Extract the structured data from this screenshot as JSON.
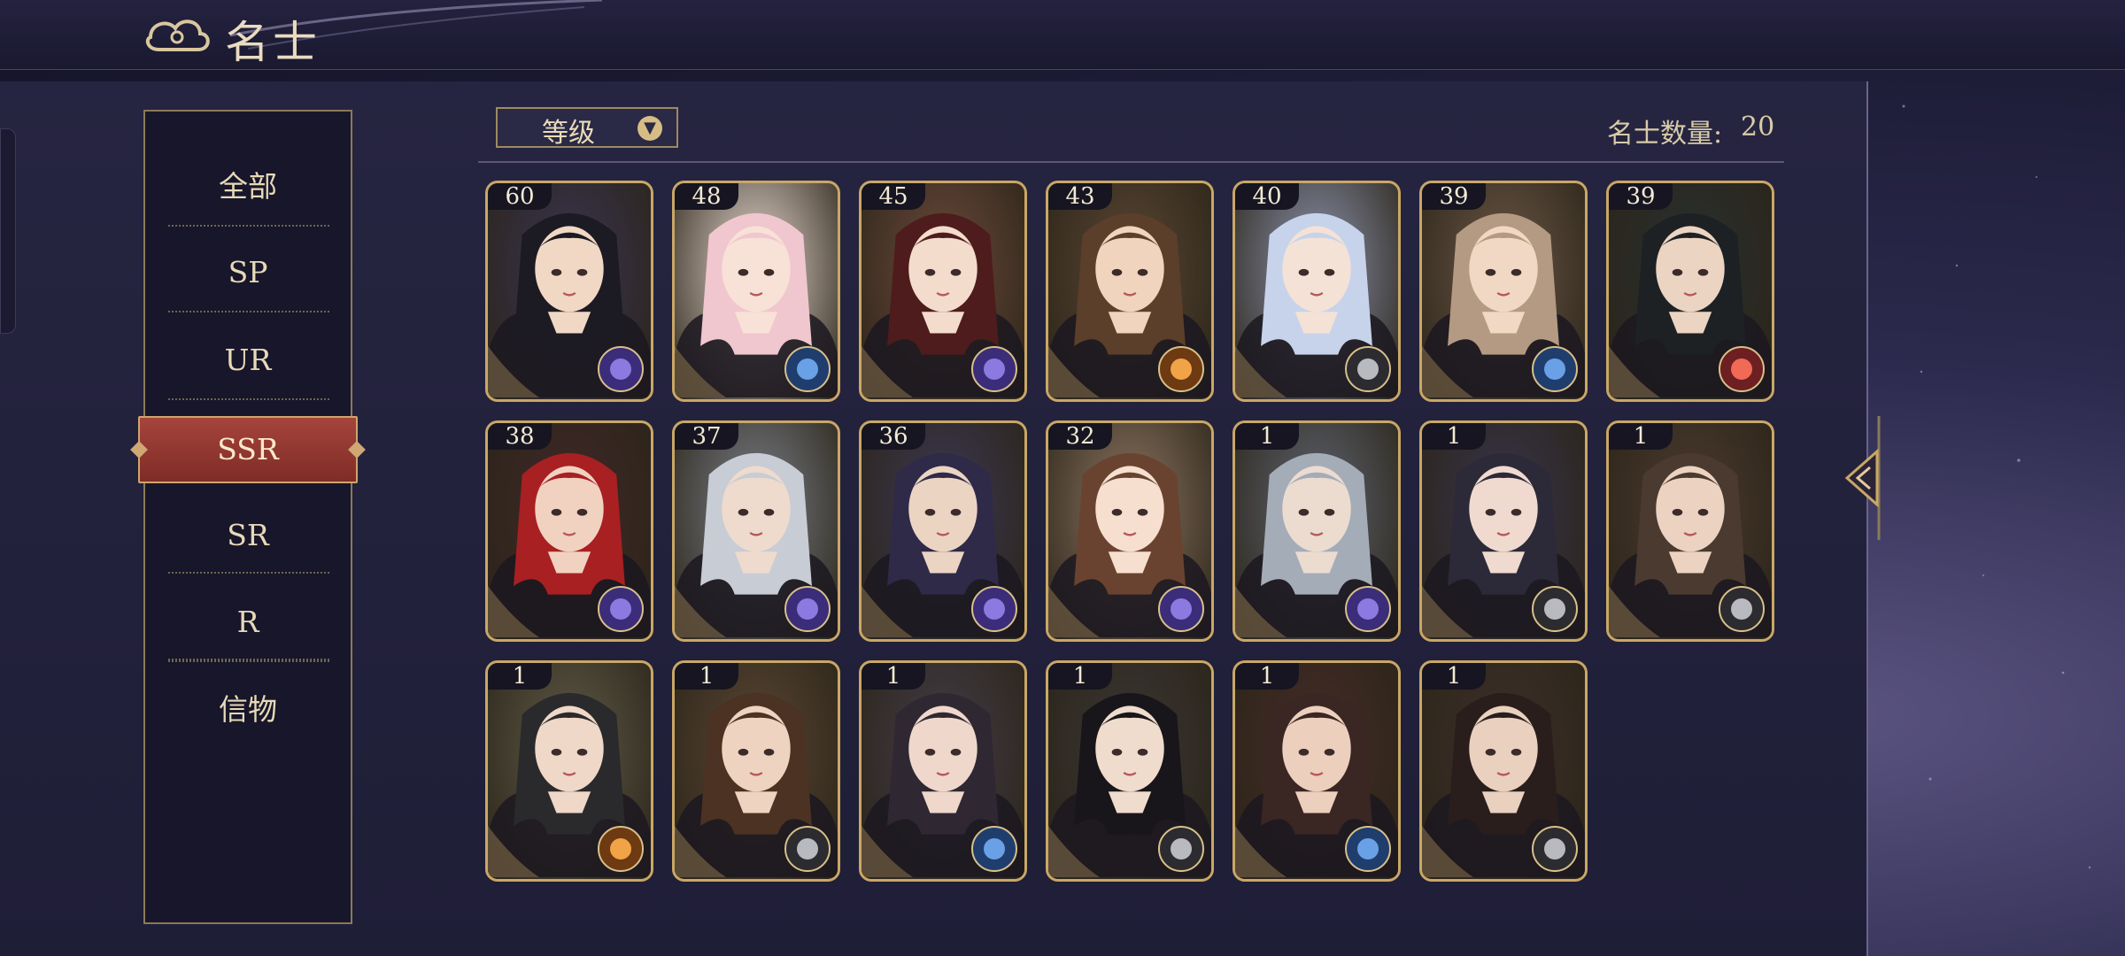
{
  "header": {
    "title": "名士"
  },
  "categories": [
    {
      "label": "全部",
      "active": false
    },
    {
      "label": "SP",
      "active": false
    },
    {
      "label": "UR",
      "active": false
    },
    {
      "label": "SSR",
      "active": true
    },
    {
      "label": "SR",
      "active": false
    },
    {
      "label": "R",
      "active": false
    },
    {
      "label": "信物",
      "active": false
    }
  ],
  "sort": {
    "label": "等级",
    "icon": "chevron-down-icon"
  },
  "count": {
    "label": "名士数量:",
    "value": "20"
  },
  "colors": {
    "accent_gold": "#c9a766",
    "active_red": "#9b3c35",
    "text_cream": "#e7d9b8"
  },
  "cards": [
    {
      "level": "60",
      "hair": "#1c1a22",
      "skin": "#f1d8c4",
      "bg": "#3a3452",
      "badge": "purple-globe-icon"
    },
    {
      "level": "48",
      "hair": "#f0c6cf",
      "skin": "#f8e1d6",
      "bg": "#e7d8d0",
      "badge": "blue-globe-icon"
    },
    {
      "level": "45",
      "hair": "#4e1c1c",
      "skin": "#f3dccc",
      "bg": "#6c4a3c",
      "badge": "purple-globe-icon"
    },
    {
      "level": "43",
      "hair": "#5b3f2a",
      "skin": "#f0d4bd",
      "bg": "#5a4633",
      "badge": "orange-globe-icon"
    },
    {
      "level": "40",
      "hair": "#c7d3ea",
      "skin": "#f4e2d6",
      "bg": "#8c93ad",
      "badge": "grey-compass-icon"
    },
    {
      "level": "39",
      "hair": "#b49a82",
      "skin": "#f1d8c4",
      "bg": "#6a5646",
      "badge": "blue-globe-icon"
    },
    {
      "level": "39",
      "hair": "#1d2124",
      "skin": "#ecd4c2",
      "bg": "#2a3030",
      "badge": "red-globe-icon"
    },
    {
      "level": "38",
      "hair": "#a82022",
      "skin": "#f1d2c0",
      "bg": "#402828",
      "badge": "purple-globe-icon"
    },
    {
      "level": "37",
      "hair": "#c8ccd4",
      "skin": "#eedbcd",
      "bg": "#7b7f88",
      "badge": "purple-globe-icon"
    },
    {
      "level": "36",
      "hair": "#2e2a48",
      "skin": "#ecd4c3",
      "bg": "#3c3852",
      "badge": "purple-globe-icon"
    },
    {
      "level": "32",
      "hair": "#6a4330",
      "skin": "#f6dfcf",
      "bg": "#8d7562",
      "badge": "purple-globe-icon"
    },
    {
      "level": "1",
      "hair": "#a4acb8",
      "skin": "#ecdcd0",
      "bg": "#5f6470",
      "badge": "purple-globe-icon"
    },
    {
      "level": "1",
      "hair": "#2c2a38",
      "skin": "#f0dad0",
      "bg": "#38344a",
      "badge": "grey-compass-icon"
    },
    {
      "level": "1",
      "hair": "#4a3a30",
      "skin": "#ecd2c0",
      "bg": "#4c3a30",
      "badge": "grey-compass-icon"
    },
    {
      "level": "1",
      "hair": "#2a2a2c",
      "skin": "#efd8c8",
      "bg": "#5f5a48",
      "badge": "orange-globe-icon"
    },
    {
      "level": "1",
      "hair": "#4b3222",
      "skin": "#eed4c0",
      "bg": "#5a4634",
      "badge": "grey-compass-icon"
    },
    {
      "level": "1",
      "hair": "#2f2832",
      "skin": "#efd8cb",
      "bg": "#433c48",
      "badge": "blue-globe-icon"
    },
    {
      "level": "1",
      "hair": "#18161a",
      "skin": "#f0dccd",
      "bg": "#3a3634",
      "badge": "grey-compass-icon"
    },
    {
      "level": "1",
      "hair": "#3a2622",
      "skin": "#eccfbd",
      "bg": "#452c28",
      "badge": "blue-globe-icon"
    },
    {
      "level": "1",
      "hair": "#2a1e1c",
      "skin": "#ead0bf",
      "bg": "#3e302a",
      "badge": "grey-compass-icon"
    }
  ]
}
